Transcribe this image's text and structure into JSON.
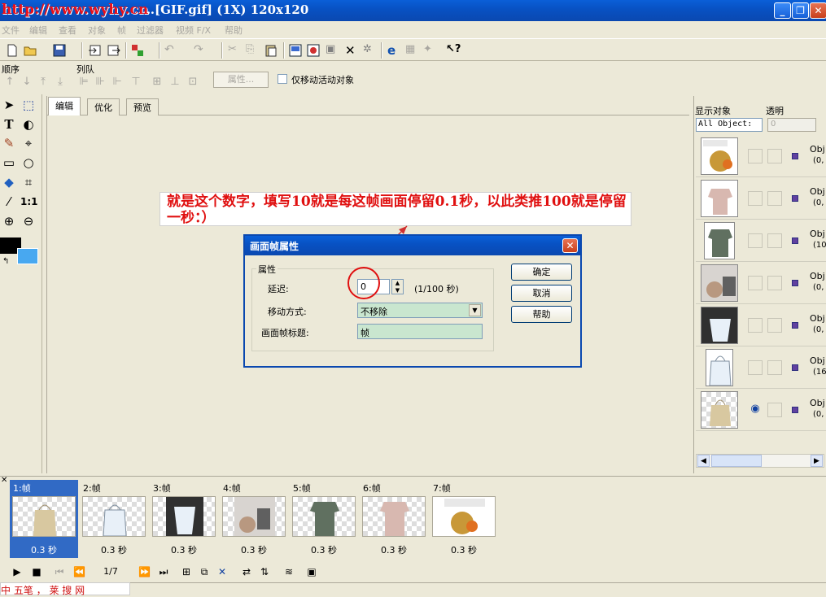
{
  "window": {
    "title": "……[GIF.gif] (1X) 120x120",
    "watermark": "http://www.wyhy.cn"
  },
  "menu": [
    "文件",
    "编辑",
    "查看",
    "对象",
    "帧",
    "过滤器",
    "视频 F/X",
    "帮助"
  ],
  "toolbar2": {
    "order_label": "顺序",
    "arrange_label": "列队",
    "props_button": "属性...",
    "only_move_label": "仅移动活动对象"
  },
  "tabs": [
    "编辑",
    "优化",
    "预览"
  ],
  "annotation": "就是这个数字，填写10就是每这帧画面停留0.1秒，以此类推100就是停留一秒：）",
  "dialog": {
    "title": "画面帧属性",
    "group_label": "属性",
    "delay_label": "延迟:",
    "delay_value": "0",
    "delay_unit": "(1/100 秒)",
    "move_label": "移动方式:",
    "move_value": "不移除",
    "frame_title_label": "画面帧标题:",
    "frame_title_value": "帧",
    "ok": "确定",
    "cancel": "取消",
    "help": "帮助"
  },
  "right_panel": {
    "show_objects_label": "显示对象",
    "opacity_label": "透明",
    "select_value": "All Object:",
    "opacity_value": "0",
    "objects": [
      {
        "name": "Obj",
        "pos": "(0,"
      },
      {
        "name": "Obj",
        "pos": "(0,"
      },
      {
        "name": "Obj",
        "pos": "(10"
      },
      {
        "name": "Obj",
        "pos": "(0,"
      },
      {
        "name": "Obj",
        "pos": "(0,"
      },
      {
        "name": "Obj",
        "pos": "(16"
      },
      {
        "name": "Obj",
        "pos": "(0,"
      }
    ]
  },
  "frames": [
    {
      "label": "1:帧",
      "delay": "0.3 秒"
    },
    {
      "label": "2:帧",
      "delay": "0.3 秒"
    },
    {
      "label": "3:帧",
      "delay": "0.3 秒"
    },
    {
      "label": "4:帧",
      "delay": "0.3 秒"
    },
    {
      "label": "5:帧",
      "delay": "0.3 秒"
    },
    {
      "label": "6:帧",
      "delay": "0.3 秒"
    },
    {
      "label": "7:帧",
      "delay": "0.3 秒"
    }
  ],
  "playbar": {
    "frame_counter": "1/7"
  },
  "ime": "中 五笔 ， 莱 搜 网",
  "colors": {
    "foreground": "#000000",
    "background": "#48a8f0",
    "selection": "#316ac5",
    "annotation": "#e01010"
  }
}
